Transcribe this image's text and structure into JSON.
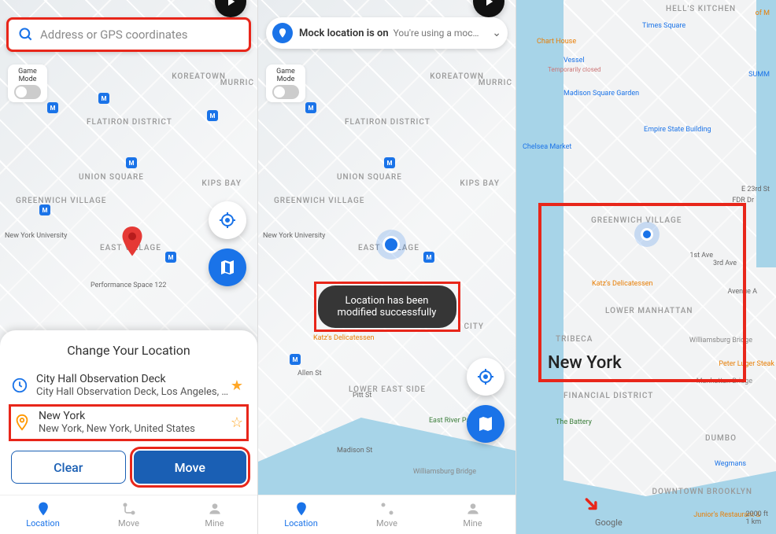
{
  "panel1": {
    "search_placeholder": "Address or GPS coordinates",
    "game_mode": "Game Mode",
    "sheet_title": "Change Your Location",
    "locations": [
      {
        "title": "City Hall Observation Deck",
        "sub": "City Hall Observation Deck, Los Angeles, …",
        "starred": true,
        "icon": "history"
      },
      {
        "title": "New York",
        "sub": "New York, New York, United States",
        "starred": false,
        "icon": "pin"
      }
    ],
    "clear_btn": "Clear",
    "move_btn": "Move",
    "areas": [
      "KOREATOWN",
      "FLATIRON DISTRICT",
      "UNION SQUARE",
      "GREENWICH VILLAGE",
      "EAST VILLAGE",
      "KIPS BAY",
      "MURRIC"
    ],
    "poi": [
      "New York University",
      "Performance Space 122"
    ]
  },
  "panel2": {
    "mock_title": "Mock location is on",
    "mock_sub": "You're using a moc…",
    "game_mode": "Game Mode",
    "toast": "Location has been modified successfully",
    "areas": [
      "KOREATOWN",
      "FLATIRON DISTRICT",
      "UNION SQUARE",
      "GREENWICH VILLAGE",
      "EAST VILLAGE",
      "KIPS BAY",
      "LOWER EAST SIDE",
      "CITY",
      "MURRIC"
    ],
    "poi": [
      "New York University",
      "Katz's Delicatessen",
      "East River Park",
      "Williamsburg Bridge",
      "Madison St",
      "Pitt St",
      "Allen St"
    ]
  },
  "panel3": {
    "box_label": "New York",
    "labels": {
      "hells": "HELL'S KITCHEN",
      "times": "Times Square",
      "chart": "Chart House",
      "vessel": "Vessel",
      "closed": "Temporarily closed",
      "msg": "Madison Square Garden",
      "esb": "Empire State Building",
      "chelsea": "Chelsea Market",
      "gv": "GREENWICH VILLAGE",
      "katz": "Katz's Delicatessen",
      "lm": "LOWER MANHATTAN",
      "tribeca": "TRIBECA",
      "wbrg": "Williamsburg Bridge",
      "luger": "Peter Luger Steak",
      "mhbrg": "Manhattan Bridge",
      "fd": "FINANCIAL DISTRICT",
      "battery": "The Battery",
      "dumbo": "DUMBO",
      "wegmans": "Wegmans",
      "dtbk": "DOWNTOWN BROOKLYN",
      "juniors": "Junior's Restaurant &",
      "summ": "SUMM",
      "mofm": "of M",
      "fdr": "FDR Dr",
      "e23": "E 23rd St",
      "ave1": "1st Ave",
      "ave3": "3rd Ave",
      "aveA": "Avenue A"
    },
    "scale": {
      "ft": "2000 ft",
      "km": "1 km"
    },
    "attribution": "Google"
  },
  "nav": {
    "location": "Location",
    "move": "Move",
    "mine": "Mine"
  },
  "colors": {
    "primary": "#1a73e8",
    "accent": "#1a5fb4",
    "highlight": "#e8261a"
  }
}
